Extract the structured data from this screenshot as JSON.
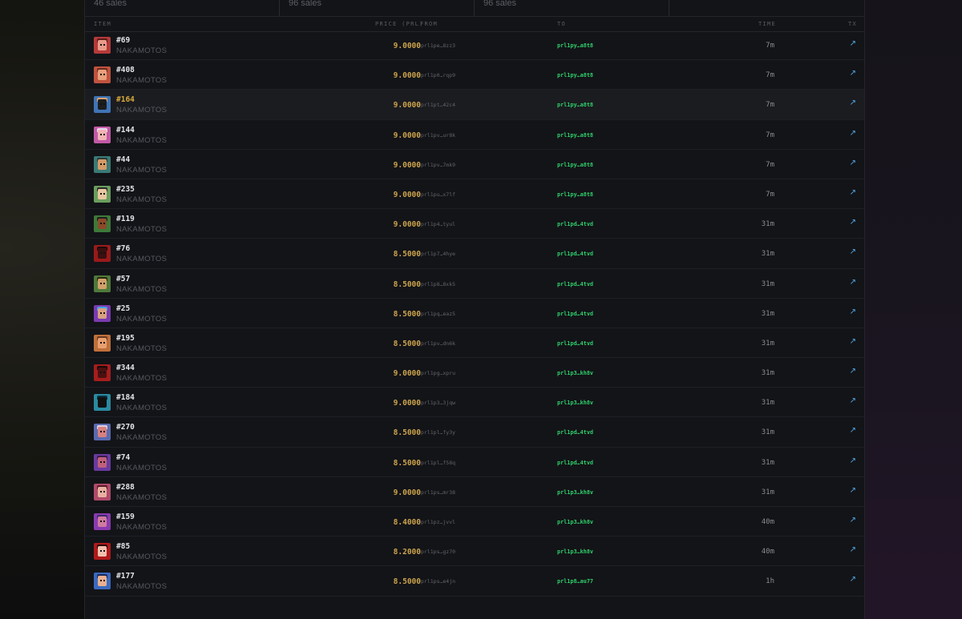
{
  "stats": [
    {
      "label": "46 sales"
    },
    {
      "label": "96 sales"
    },
    {
      "label": "96 sales"
    },
    {
      "label": ""
    }
  ],
  "table": {
    "headers": {
      "item": "ITEM",
      "price": "PRICE (PRL)",
      "from": "FROM",
      "to": "TO",
      "time": "TIME",
      "tx": "TX"
    },
    "tx_icon": "↗",
    "rows": [
      {
        "num": "#69",
        "collection": "NAKAMOTOS",
        "price": "9.0000",
        "from": "prl1pe…8zz3",
        "to": "prl1py…a8t8",
        "time": "7m",
        "colors": [
          "#b53a3a",
          "#e89b8a",
          "#5a1a1a"
        ]
      },
      {
        "num": "#408",
        "collection": "NAKAMOTOS",
        "price": "9.0000",
        "from": "prl1p0…rqp9",
        "to": "prl1py…a8t8",
        "time": "7m",
        "colors": [
          "#c0533e",
          "#e8a07c",
          "#6b2a1c"
        ]
      },
      {
        "num": "#164",
        "collection": "NAKAMOTOS",
        "price": "9.0000",
        "from": "prl1pt…42c4",
        "to": "prl1py…a8t8",
        "time": "7m",
        "colors": [
          "#3f74b8",
          "#1d1d1d",
          "#d9a26a"
        ],
        "highlight": true
      },
      {
        "num": "#144",
        "collection": "NAKAMOTOS",
        "price": "9.0000",
        "from": "prl1pv…ur8k",
        "to": "prl1py…a8t8",
        "time": "7m",
        "colors": [
          "#c25aa5",
          "#f0b4b4",
          "#e8d6f0"
        ]
      },
      {
        "num": "#44",
        "collection": "NAKAMOTOS",
        "price": "9.0000",
        "from": "prl1pv…7mk9",
        "to": "prl1py…a8t8",
        "time": "7m",
        "colors": [
          "#3a7a76",
          "#d39a68",
          "#2a3a3a"
        ]
      },
      {
        "num": "#235",
        "collection": "NAKAMOTOS",
        "price": "9.0000",
        "from": "prl1pu…x7lf",
        "to": "prl1py…a8t8",
        "time": "7m",
        "colors": [
          "#6a9e5e",
          "#e8c7a0",
          "#2a2a2a"
        ]
      },
      {
        "num": "#119",
        "collection": "NAKAMOTOS",
        "price": "9.0000",
        "from": "prl1p4…tyul",
        "to": "prl1pd…4tvd",
        "time": "31m",
        "colors": [
          "#3d7a3a",
          "#8a4a2a",
          "#1e1e1e"
        ]
      },
      {
        "num": "#76",
        "collection": "NAKAMOTOS",
        "price": "8.5000",
        "from": "prl1p7…4hye",
        "to": "prl1pd…4tvd",
        "time": "31m",
        "colors": [
          "#9a1a1a",
          "#3a1010",
          "#1a0a0a"
        ]
      },
      {
        "num": "#57",
        "collection": "NAKAMOTOS",
        "price": "8.5000",
        "from": "prl1p8…8xk5",
        "to": "prl1pd…4tvd",
        "time": "31m",
        "colors": [
          "#4e7a3a",
          "#d1a16a",
          "#2a2a10"
        ]
      },
      {
        "num": "#25",
        "collection": "NAKAMOTOS",
        "price": "8.5000",
        "from": "prl1pq…eaz5",
        "to": "prl1pd…4tvd",
        "time": "31m",
        "colors": [
          "#7a3ab0",
          "#d8a080",
          "#4aa0e0"
        ]
      },
      {
        "num": "#195",
        "collection": "NAKAMOTOS",
        "price": "8.5000",
        "from": "prl1pv…dn6k",
        "to": "prl1pd…4tvd",
        "time": "31m",
        "colors": [
          "#c0703a",
          "#e8a070",
          "#6a3a20"
        ]
      },
      {
        "num": "#344",
        "collection": "NAKAMOTOS",
        "price": "9.0000",
        "from": "prl1pg…xpru",
        "to": "prl1p3…kh8v",
        "time": "31m",
        "colors": [
          "#a51d1d",
          "#4a1010",
          "#1a0808"
        ]
      },
      {
        "num": "#184",
        "collection": "NAKAMOTOS",
        "price": "9.0000",
        "from": "prl1p3…3jqw",
        "to": "prl1p3…kh8v",
        "time": "31m",
        "colors": [
          "#2a8aa0",
          "#101010",
          "#0a3040"
        ]
      },
      {
        "num": "#270",
        "collection": "NAKAMOTOS",
        "price": "8.5000",
        "from": "prl1pl…fy3y",
        "to": "prl1pd…4tvd",
        "time": "31m",
        "colors": [
          "#5a6ab0",
          "#d88080",
          "#e0d0e0"
        ]
      },
      {
        "num": "#74",
        "collection": "NAKAMOTOS",
        "price": "8.5000",
        "from": "prl1pl…f58q",
        "to": "prl1pd…4tvd",
        "time": "31m",
        "colors": [
          "#6a3aa0",
          "#c0607a",
          "#3a1a4a"
        ]
      },
      {
        "num": "#288",
        "collection": "NAKAMOTOS",
        "price": "9.0000",
        "from": "prl1ps…mr38",
        "to": "prl1p3…kh8v",
        "time": "31m",
        "colors": [
          "#b04a6a",
          "#e8b0a0",
          "#5a1a2a"
        ]
      },
      {
        "num": "#159",
        "collection": "NAKAMOTOS",
        "price": "8.4000",
        "from": "prl1pz…jvvl",
        "to": "prl1p3…kh8v",
        "time": "40m",
        "colors": [
          "#8a3ab0",
          "#d07aa0",
          "#3a2a6a"
        ]
      },
      {
        "num": "#85",
        "collection": "NAKAMOTOS",
        "price": "8.2000",
        "from": "prl1ps…gz70",
        "to": "prl1p3…kh8v",
        "time": "40m",
        "colors": [
          "#b01a1a",
          "#f0c0b0",
          "#2a0a0a"
        ]
      },
      {
        "num": "#177",
        "collection": "NAKAMOTOS",
        "price": "8.5000",
        "from": "prl1ps…e4jn",
        "to": "prl1p8…au77",
        "time": "1h",
        "colors": [
          "#3a6ac0",
          "#e8b090",
          "#1a2a5a"
        ]
      }
    ]
  }
}
